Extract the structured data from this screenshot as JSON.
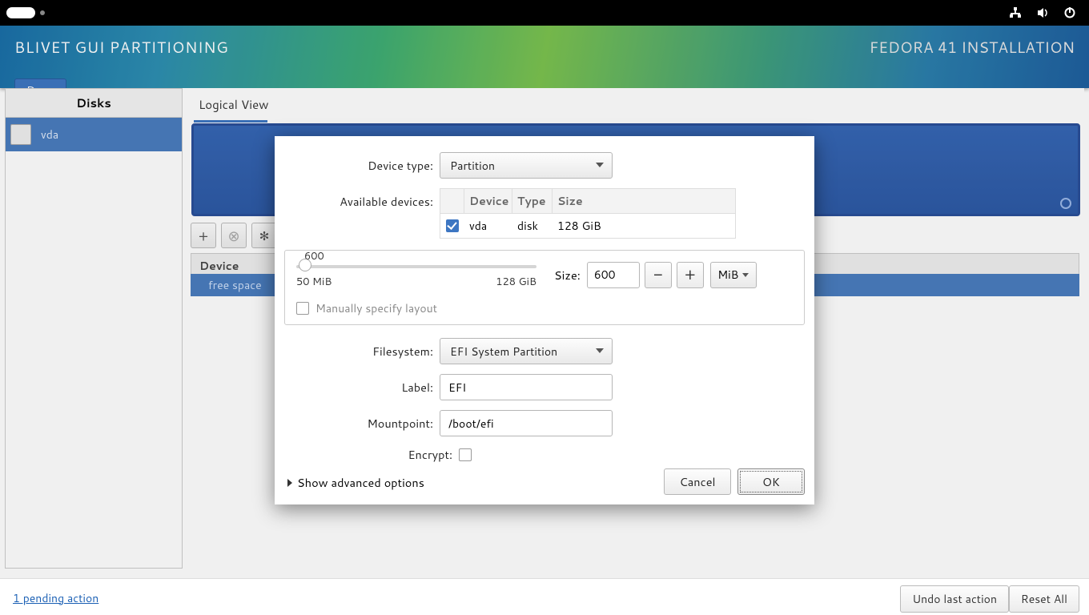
{
  "header": {
    "title": "BLIVET GUI PARTITIONING",
    "right": "FEDORA 41 INSTALLATION",
    "done": "Done"
  },
  "sidebar": {
    "disks_header": "Disks",
    "disk_name": "vda"
  },
  "content": {
    "tab": "Logical View",
    "device_header": "Device",
    "free_space": "free space"
  },
  "footer": {
    "pending": "1 pending action",
    "undo": "Undo last action",
    "reset": "Reset All"
  },
  "dialog": {
    "device_type_label": "Device type:",
    "device_type_value": "Partition",
    "avail_label": "Available devices:",
    "table": {
      "headers": {
        "device": "Device",
        "type": "Type",
        "size": "Size"
      },
      "row": {
        "device": "vda",
        "type": "disk",
        "size": "128 GiB",
        "checked": true
      }
    },
    "size": {
      "label": "Size:",
      "value": "600",
      "unit": "MiB",
      "slider_value_label": "600",
      "slider_min": "50 MiB",
      "slider_max": "128 GiB"
    },
    "manual_layout": "Manually specify layout",
    "filesystem_label": "Filesystem:",
    "filesystem_value": "EFI System Partition",
    "label_label": "Label:",
    "label_value": "EFI",
    "mount_label": "Mountpoint:",
    "mount_value": "/boot/efi",
    "encrypt_label": "Encrypt:",
    "advanced": "Show advanced options",
    "cancel": "Cancel",
    "ok": "OK"
  }
}
